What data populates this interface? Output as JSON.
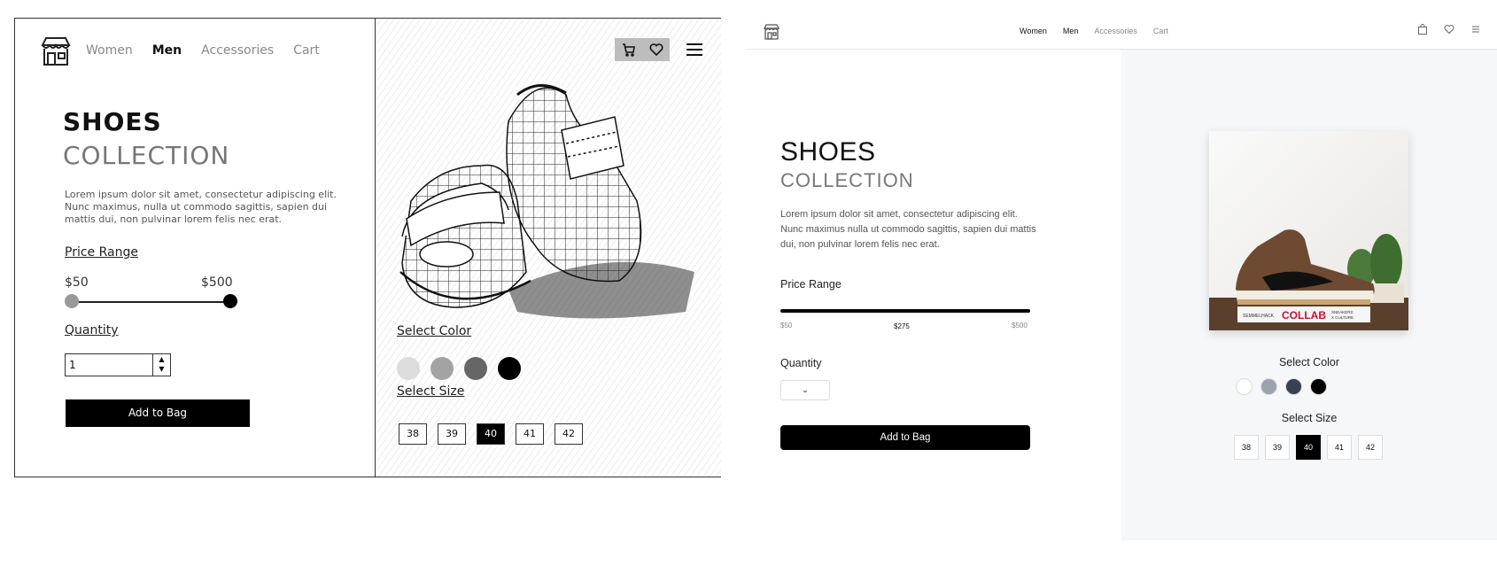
{
  "wireframe": {
    "nav": [
      "Women",
      "Men",
      "Accessories",
      "Cart"
    ],
    "title_line1": "SHOES",
    "title_line2": "COLLECTION",
    "description": "Lorem ipsum dolor sit amet, consectetur adipiscing elit. Nunc maximus, nulla ut commodo sagittis, sapien dui mattis dui, non pulvinar lorem felis nec erat.",
    "price_label": "Price Range",
    "price_min": "$50",
    "price_max": "$500",
    "quantity_label": "Quantity",
    "quantity_value": "1",
    "add_button": "Add to Bag",
    "color_label": "Select Color",
    "colors": [
      "#dcdcdc",
      "#a3a3a3",
      "#666666",
      "#000000"
    ],
    "size_label": "Select Size",
    "sizes": [
      "38",
      "39",
      "40",
      "41",
      "42"
    ],
    "selected_size": "40"
  },
  "mockup": {
    "nav": [
      "Women",
      "Men",
      "Accessories",
      "Cart"
    ],
    "title_line1": "SHOES",
    "title_line2": "COLLECTION",
    "description": "Lorem ipsum dolor sit amet, consectetur adipiscing elit. Nunc maximus nulla ut commodo sagittis, sapien dui mattis dui, non pulvinar lorem felis nec erat.",
    "price_label": "Price Range",
    "price_min": "$50",
    "price_current": "$275",
    "price_max": "$500",
    "quantity_label": "Quantity",
    "add_button": "Add to Bag",
    "color_label": "Select Color",
    "colors": [
      "#ffffff",
      "#9ca3af",
      "#374151",
      "#000000"
    ],
    "size_label": "Select Size",
    "sizes": [
      "38",
      "39",
      "40",
      "41",
      "42"
    ],
    "selected_size": "40",
    "photo_caption": {
      "left": "SEMMELHACK",
      "center": "COLLAB",
      "right1": "SNEAKERS",
      "right2": "X CULTURE"
    }
  }
}
